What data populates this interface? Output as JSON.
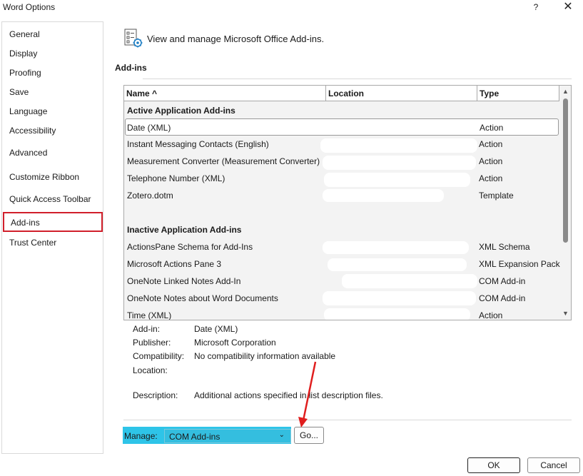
{
  "window": {
    "title": "Word Options",
    "help_glyph": "?",
    "close_glyph": "✕"
  },
  "sidebar": {
    "items": [
      {
        "label": "General"
      },
      {
        "label": "Display"
      },
      {
        "label": "Proofing"
      },
      {
        "label": "Save"
      },
      {
        "label": "Language"
      },
      {
        "label": "Accessibility"
      },
      {
        "label": "Advanced"
      },
      {
        "label": "Customize Ribbon"
      },
      {
        "label": "Quick Access Toolbar"
      },
      {
        "label": "Add-ins",
        "selected": true
      },
      {
        "label": "Trust Center"
      }
    ]
  },
  "header": {
    "text": "View and manage Microsoft Office Add-ins."
  },
  "section": {
    "label": "Add-ins"
  },
  "table": {
    "columns": [
      "Name ^",
      "Location",
      "Type"
    ],
    "groups": [
      {
        "label": "Active Application Add-ins",
        "rows": [
          {
            "name": "Date (XML)",
            "location": "",
            "type": "Action",
            "selected": true
          },
          {
            "name": "Instant Messaging Contacts (English)",
            "location": "",
            "type": "Action"
          },
          {
            "name": "Measurement Converter (Measurement Converter)",
            "location": "",
            "type": "Action"
          },
          {
            "name": "Telephone Number (XML)",
            "location": "",
            "type": "Action"
          },
          {
            "name": "Zotero.dotm",
            "location": "",
            "type": "Template"
          }
        ]
      },
      {
        "label": "Inactive Application Add-ins",
        "rows": [
          {
            "name": "ActionsPane Schema for Add-Ins",
            "location": "",
            "type": "XML Schema"
          },
          {
            "name": "Microsoft Actions Pane 3",
            "location": "",
            "type": "XML Expansion Pack"
          },
          {
            "name": "OneNote Linked Notes Add-In",
            "location": "",
            "type": "COM Add-in"
          },
          {
            "name": "OneNote Notes about Word Documents",
            "location": "",
            "type": "COM Add-in"
          },
          {
            "name": "Time (XML)",
            "location": "",
            "type": "Action"
          }
        ]
      }
    ]
  },
  "details": {
    "addin_label": "Add-in:",
    "addin_value": "Date (XML)",
    "publisher_label": "Publisher:",
    "publisher_value": "Microsoft Corporation",
    "compat_label": "Compatibility:",
    "compat_value": "No compatibility information available",
    "location_label": "Location:",
    "location_value": "",
    "description_label": "Description:",
    "description_value": "Additional actions specified in list description files."
  },
  "manage": {
    "label": "Manage:",
    "selected": "COM Add-ins",
    "go_label": "Go..."
  },
  "footer": {
    "ok_label": "OK",
    "cancel_label": "Cancel"
  },
  "colors": {
    "selection_border": "#d11f2b",
    "highlight": "#2ec4e8",
    "annotation_arrow": "#e01e1e"
  },
  "icons": {
    "header": "addins-list-gear-icon",
    "close": "close-icon",
    "help": "help-icon",
    "chevron": "chevron-down-icon"
  }
}
